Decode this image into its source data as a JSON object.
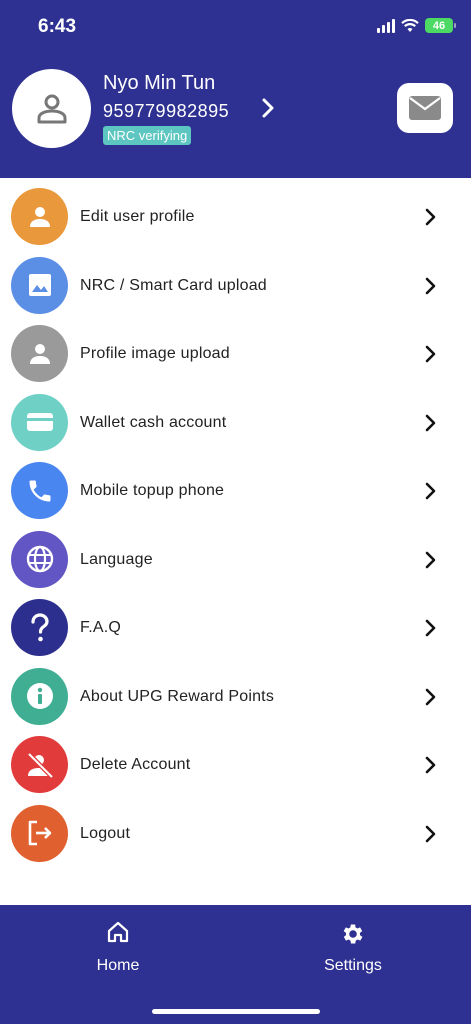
{
  "status_bar": {
    "time": "6:43",
    "battery": "46"
  },
  "profile": {
    "name": "Nyo Min Tun",
    "phone": "959779982895",
    "badge": "NRC verifying"
  },
  "menu": [
    {
      "label": "Edit user profile",
      "icon": "user-icon",
      "color": "#e9983b"
    },
    {
      "label": "NRC / Smart Card upload",
      "icon": "image-icon",
      "color": "#5b8fe6"
    },
    {
      "label": "Profile image upload",
      "icon": "user-icon",
      "color": "#9a9a9a"
    },
    {
      "label": "Wallet cash account",
      "icon": "card-icon",
      "color": "#6fd0c6"
    },
    {
      "label": "Mobile topup phone",
      "icon": "phone-icon",
      "color": "#4a86f0"
    },
    {
      "label": "Language",
      "icon": "globe-icon",
      "color": "#6156c4"
    },
    {
      "label": "F.A.Q",
      "icon": "question-icon",
      "color": "#2d2f8f"
    },
    {
      "label": "About UPG Reward Points",
      "icon": "info-icon",
      "color": "#3fae93"
    },
    {
      "label": "Delete Account",
      "icon": "user-off-icon",
      "color": "#e23b3b"
    },
    {
      "label": "Logout",
      "icon": "logout-icon",
      "color": "#e0602f"
    }
  ],
  "bottom_nav": {
    "home_label": "Home",
    "settings_label": "Settings"
  },
  "colors": {
    "brand": "#2e3191"
  }
}
